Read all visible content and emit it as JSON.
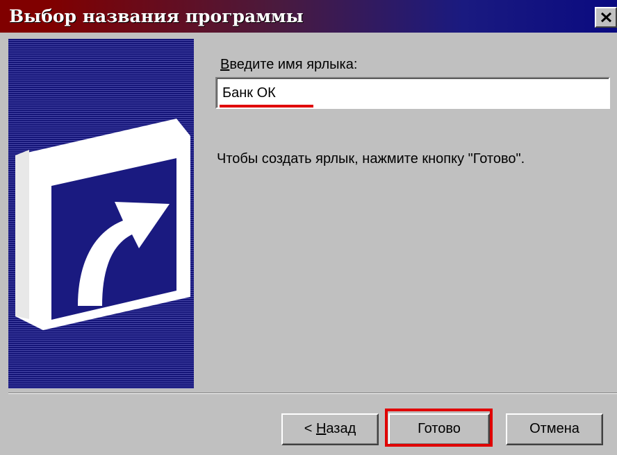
{
  "window": {
    "title": "Выбор названия программы",
    "close_glyph": "✕"
  },
  "form": {
    "label_accesskey": "В",
    "label_rest": "ведите имя ярлыка:",
    "name_value": "Банк ОК"
  },
  "instruction": "Чтобы создать ярлык, нажмите кнопку \"Готово\".",
  "buttons": {
    "back_prefix": "< ",
    "back_accesskey": "Н",
    "back_rest": "азад",
    "finish": "Готово",
    "cancel": "Отмена"
  },
  "icons": {
    "close": "close-icon",
    "side_graphic": "shortcut-arrow-icon"
  },
  "colors": {
    "titlebar_start": "#800000",
    "titlebar_end": "#0a0a80",
    "panel": "#1a1a80",
    "highlight": "#e00000",
    "face": "#c0c0c0"
  }
}
